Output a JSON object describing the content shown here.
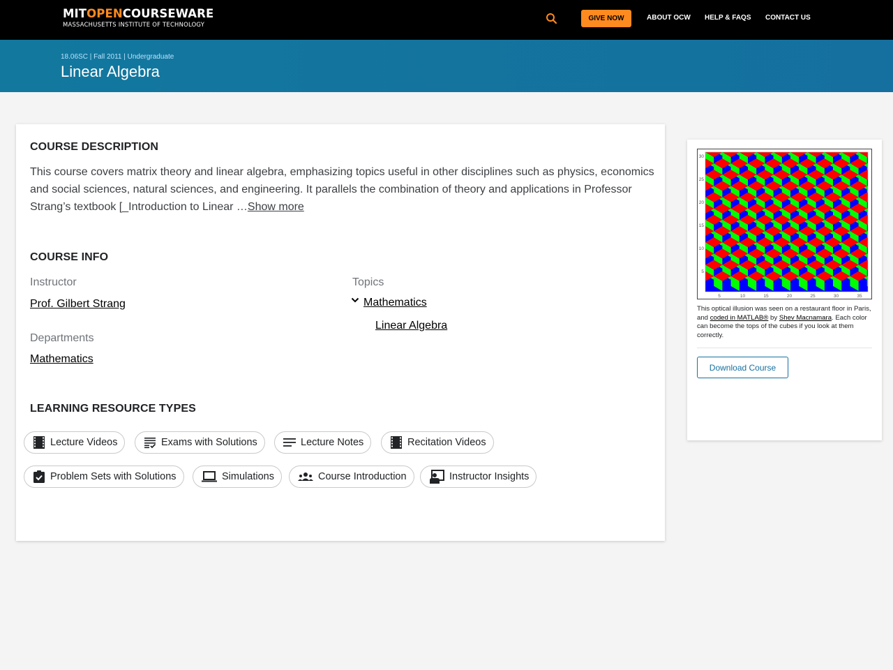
{
  "header": {
    "logo": {
      "part1": "MIT",
      "part2": "OPEN",
      "part3": "COURSEWARE",
      "subtitle": "MASSACHUSETTS INSTITUTE OF TECHNOLOGY"
    },
    "search_icon": "search-icon",
    "give_label": "GIVE NOW",
    "nav": [
      "ABOUT OCW",
      "HELP & FAQS",
      "CONTACT US"
    ],
    "colors": {
      "accent": "#ff8a1f",
      "background": "#000000"
    }
  },
  "banner": {
    "meta": "18.06SC | Fall 2011 | Undergraduate",
    "title": "Linear Algebra",
    "color": "#15709f"
  },
  "course_description": {
    "heading": "COURSE DESCRIPTION",
    "text": "This course covers matrix theory and linear algebra, emphasizing topics useful in other disciplines such as physics, economics and social sciences, natural sciences, and engineering. It parallels the combination of theory and applications in Professor Strang’s textbook [_Introduction to Linear …",
    "show_more": "Show more"
  },
  "course_info": {
    "heading": "COURSE INFO",
    "instructor_label": "Instructor",
    "instructor": "Prof. Gilbert Strang",
    "departments_label": "Departments",
    "department": "Mathematics",
    "topics_label": "Topics",
    "topic": "Mathematics",
    "subtopic": "Linear Algebra",
    "topic_expand_icon": "chevron-down-icon"
  },
  "learning_resource_types": {
    "heading": "LEARNING RESOURCE TYPES",
    "items": [
      {
        "label": "Lecture Videos",
        "icon": "film-icon"
      },
      {
        "label": "Exams with Solutions",
        "icon": "checklist-icon"
      },
      {
        "label": "Lecture Notes",
        "icon": "notes-icon"
      },
      {
        "label": "Recitation Videos",
        "icon": "film-icon"
      },
      {
        "label": "Problem Sets with Solutions",
        "icon": "clipboard-check-icon"
      },
      {
        "label": "Simulations",
        "icon": "laptop-icon"
      },
      {
        "label": "Course Introduction",
        "icon": "group-icon"
      },
      {
        "label": "Instructor Insights",
        "icon": "presenter-icon"
      }
    ]
  },
  "sidebar": {
    "image_alt": "Optical illusion pattern of red, green and blue rhombi forming cubes",
    "image_axis": {
      "x_ticks": [
        "5",
        "10",
        "15",
        "20",
        "25",
        "30",
        "35"
      ],
      "y_ticks": [
        "5",
        "10",
        "15",
        "20",
        "25",
        "30"
      ]
    },
    "image_colors": [
      "#ff0000",
      "#00ff00",
      "#0000ff"
    ],
    "caption_pre": "This optical illusion was seen on a restaurant floor in Paris, and ",
    "caption_link1": "coded in MATLAB®",
    "caption_mid": " by ",
    "caption_link2": "Shev Macnamara",
    "caption_post": ". Each color can become the tops of the cubes if you look at them correctly.",
    "download_label": "Download Course"
  }
}
